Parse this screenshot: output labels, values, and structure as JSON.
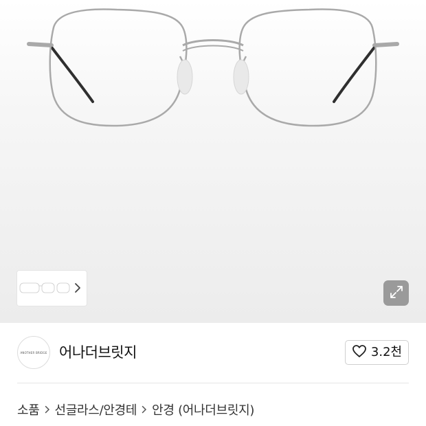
{
  "gallery": {
    "main_image": "silver-metal-eyeglasses",
    "thumbnail_image": "eyeglasses-thumbnails",
    "next_icon": "chevron-right-icon",
    "expand_icon": "expand-icon"
  },
  "brand": {
    "logo_text": "ANOTHER BRIDGE",
    "name": "어나더브릿지"
  },
  "like": {
    "icon": "heart-icon",
    "count": "3.2천"
  },
  "breadcrumb": {
    "items": [
      "소품",
      "선글라스/안경테",
      "안경 (어나더브릿지)"
    ],
    "separator_icon": "chevron-right-icon"
  },
  "colors": {
    "frame": "#a9a9a9",
    "temple_tip": "#333333",
    "expand_bg": "#9a9a9a"
  }
}
